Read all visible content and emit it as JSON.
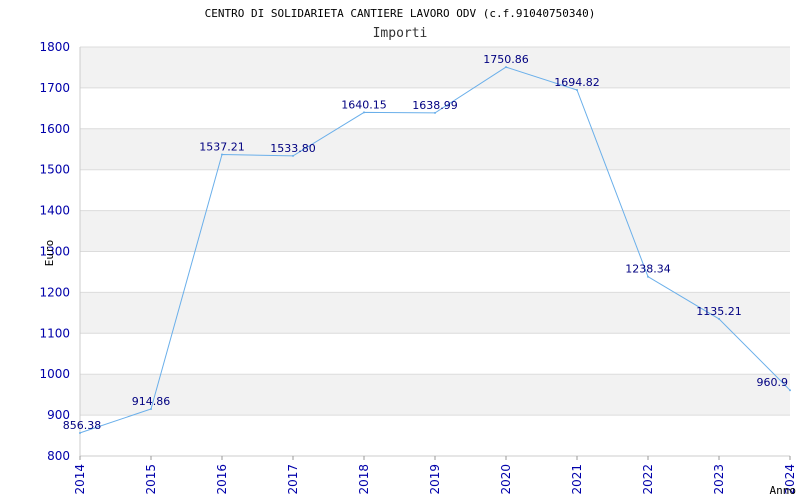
{
  "chart_data": {
    "type": "line",
    "title": "CENTRO DI SOLIDARIETA CANTIERE LAVORO ODV (c.f.91040750340)",
    "subtitle": "Importi",
    "xlabel": "Anno",
    "ylabel": "Euro",
    "categories": [
      "2014",
      "2015",
      "2016",
      "2017",
      "2018",
      "2019",
      "2020",
      "2021",
      "2022",
      "2023",
      "2024"
    ],
    "series": [
      {
        "values": [
          856.38,
          914.86,
          1537.21,
          1533.8,
          1640.15,
          1638.99,
          1750.86,
          1694.82,
          1238.34,
          1135.21,
          960.9
        ]
      }
    ],
    "data_labels": [
      "856.38",
      "914.86",
      "1537.21",
      "1533.80",
      "1640.15",
      "1638.99",
      "1750.86",
      "1694.82",
      "1238.34",
      "1135.21",
      "960.9"
    ],
    "ylim": [
      800,
      1800
    ],
    "yticks": [
      800,
      900,
      1000,
      1100,
      1200,
      1300,
      1400,
      1500,
      1600,
      1700,
      1800
    ],
    "grid": true,
    "legend": "none",
    "colors": {
      "line": "#6aafea",
      "band_shade": "#f2f2f2",
      "band_plain": "#ffffff",
      "grid": "#dcdcdc",
      "tick_text": "#0000aa",
      "data_label_text": "#000080"
    }
  }
}
